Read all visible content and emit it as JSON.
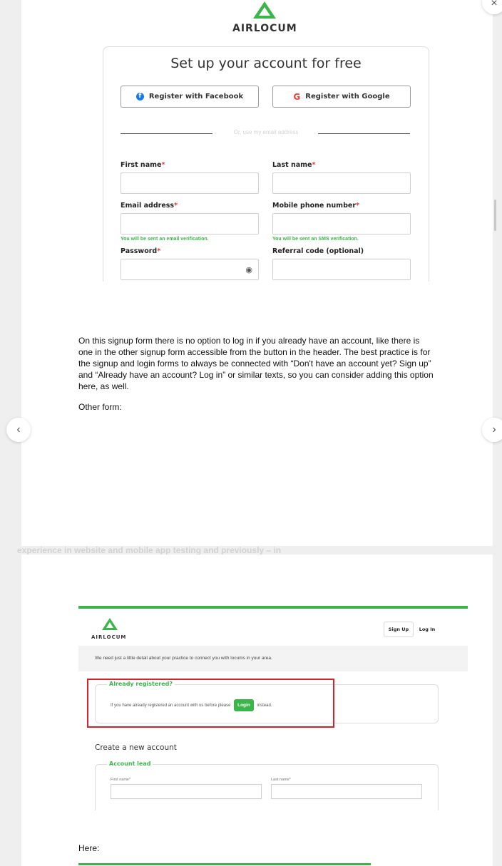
{
  "background": {
    "faint_lines": [
      "experience in website and mobile app testing and previously – in"
    ]
  },
  "nav": {
    "prev_icon": "chevron-left-icon",
    "next_icon": "chevron-right-icon",
    "close_icon": "close-icon",
    "prev_glyph": "‹",
    "next_glyph": "›",
    "close_glyph": "×"
  },
  "screenshot1": {
    "brand": "AIRLOCUM",
    "title": "Set up your account for free",
    "facebook_button": "Register with Facebook",
    "google_button": "Register with Google",
    "divider_text": "Or, use my email address",
    "fields": {
      "first_name": "First name",
      "last_name": "Last name",
      "email": "Email address",
      "mobile": "Mobile phone number",
      "password": "Password",
      "referral": "Referral code (optional)"
    },
    "required_mark": "*",
    "email_hint": "You will be sent an email verification.",
    "mobile_hint": "You will be sent an SMS verification.",
    "colors": {
      "brand_green": "#3bb54a",
      "required_red": "#e23b3b"
    }
  },
  "note": {
    "paragraph": "On this signup form there is no option to log in if you already have an account, like there is one in the other signup form accessible from the button in the header. The best practice is for the signup and login forms to always be connected with “Don't have an account yet? Sign up” and “Already have an account? Log in” or similar texts, so you can consider adding this option here, as well.",
    "other_form_label": "Other form:",
    "here_label": "Here:"
  },
  "screenshot2": {
    "brand": "AIRLOCUM",
    "signup_button": "Sign Up",
    "login_link": "Log In",
    "info_text": "We need just a little detail about your practice to connect you with locums in your area.",
    "already_registered_legend": "Already registered?",
    "already_registered_text_before": "If you have already registered an account with us before please",
    "login_button": "Login",
    "already_registered_text_after": "instead.",
    "create_title": "Create a new account",
    "account_lead_legend": "Account lead",
    "first_name_label": "First name*",
    "last_name_label": "Last name*",
    "colors": {
      "highlight_red": "#d2232a"
    }
  }
}
